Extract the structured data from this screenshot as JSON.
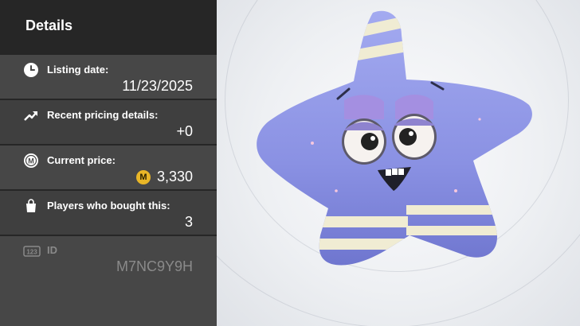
{
  "details": {
    "title": "Details",
    "listing_date": {
      "label": "Listing date:",
      "value": "11/23/2025",
      "icon": "clock-icon"
    },
    "pricing": {
      "label": "Recent pricing details:",
      "value": "+0",
      "icon": "trend-up-icon"
    },
    "price": {
      "label": "Current price:",
      "value": "3,330",
      "icon": "coin-icon",
      "coin_letter": "M"
    },
    "buyers": {
      "label": "Players who bought this:",
      "value": "3",
      "icon": "shopping-bag-icon"
    },
    "id": {
      "label": "ID",
      "value": "M7NC9Y9H",
      "icon": "id-123-icon",
      "badge_text": "123"
    }
  },
  "colors": {
    "coin": "#e9b627",
    "star_body": "#8f96e6",
    "stripe": "#f0ecd3"
  }
}
